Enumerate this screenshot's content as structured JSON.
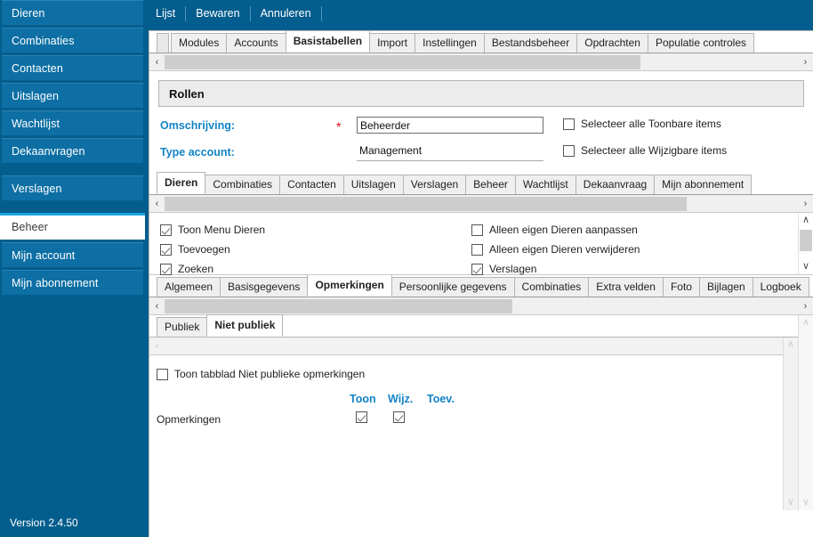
{
  "sidebar": {
    "items": [
      {
        "label": "Dieren",
        "active": false,
        "gap": false
      },
      {
        "label": "Combinaties",
        "active": false,
        "gap": false
      },
      {
        "label": "Contacten",
        "active": false,
        "gap": false
      },
      {
        "label": "Uitslagen",
        "active": false,
        "gap": false
      },
      {
        "label": "Wachtlijst",
        "active": false,
        "gap": false
      },
      {
        "label": "Dekaanvragen",
        "active": false,
        "gap": false
      },
      {
        "label": "Verslagen",
        "active": false,
        "gap": true
      },
      {
        "label": "Beheer",
        "active": true,
        "gap": true
      },
      {
        "label": "Mijn account",
        "active": false,
        "gap": false
      },
      {
        "label": "Mijn abonnement",
        "active": false,
        "gap": false
      }
    ],
    "version": "Version 2.4.50"
  },
  "topbar": {
    "items": [
      {
        "label": "Lijst"
      },
      {
        "label": "Bewaren"
      },
      {
        "label": "Annuleren"
      }
    ]
  },
  "module_tabs": [
    {
      "label": "Modules",
      "active": false
    },
    {
      "label": "Accounts",
      "active": false
    },
    {
      "label": "Basistabellen",
      "active": true
    },
    {
      "label": "Import",
      "active": false
    },
    {
      "label": "Instellingen",
      "active": false
    },
    {
      "label": "Bestandsbeheer",
      "active": false
    },
    {
      "label": "Opdrachten",
      "active": false
    },
    {
      "label": "Populatie controles",
      "active": false
    }
  ],
  "section": {
    "title": "Rollen"
  },
  "form": {
    "omschrijving_label": "Omschrijving:",
    "omschrijving_required": "*",
    "omschrijving_value": "Beheerder",
    "type_account_label": "Type account:",
    "type_account_value": "Management",
    "select_toonbare_label": "Selecteer alle Toonbare items",
    "select_toonbare_checked": false,
    "select_wijzigbare_label": "Selecteer alle Wijzigbare items",
    "select_wijzigbare_checked": false
  },
  "entity_tabs": [
    {
      "label": "Dieren",
      "active": true
    },
    {
      "label": "Combinaties",
      "active": false
    },
    {
      "label": "Contacten",
      "active": false
    },
    {
      "label": "Uitslagen",
      "active": false
    },
    {
      "label": "Verslagen",
      "active": false
    },
    {
      "label": "Beheer",
      "active": false
    },
    {
      "label": "Wachtlijst",
      "active": false
    },
    {
      "label": "Dekaanvraag",
      "active": false
    },
    {
      "label": "Mijn abonnement",
      "active": false
    }
  ],
  "permissions": {
    "left": [
      {
        "label": "Toon Menu Dieren",
        "checked": true
      },
      {
        "label": "Toevoegen",
        "checked": true
      },
      {
        "label": "Zoeken",
        "checked": true
      }
    ],
    "right": [
      {
        "label": "Alleen eigen Dieren aanpassen",
        "checked": false
      },
      {
        "label": "Alleen eigen Dieren verwijderen",
        "checked": false
      },
      {
        "label": "Verslagen",
        "checked": true
      }
    ]
  },
  "detail_tabs": [
    {
      "label": "Algemeen",
      "active": false
    },
    {
      "label": "Basisgegevens",
      "active": false
    },
    {
      "label": "Opmerkingen",
      "active": true
    },
    {
      "label": "Persoonlijke gegevens",
      "active": false
    },
    {
      "label": "Combinaties",
      "active": false
    },
    {
      "label": "Extra velden",
      "active": false
    },
    {
      "label": "Foto",
      "active": false
    },
    {
      "label": "Bijlagen",
      "active": false
    },
    {
      "label": "Logboek",
      "active": false
    }
  ],
  "sub_tabs": [
    {
      "label": "Publiek",
      "active": false
    },
    {
      "label": "Niet publiek",
      "active": true
    }
  ],
  "inner": {
    "toon_tabblad_label": "Toon tabblad Niet publieke opmerkingen",
    "toon_tabblad_checked": false,
    "col_toon": "Toon",
    "col_wijz": "Wijz.",
    "col_toev": "Toev.",
    "row_label": "Opmerkingen",
    "row_toon_checked": true,
    "row_wijz_checked": true,
    "row_toev_checked": false
  },
  "icons": {
    "scroll_left": "‹",
    "scroll_right": "›",
    "scroll_up": "∧",
    "scroll_down": "∨"
  },
  "colors": {
    "sidebar_bg": "#045e8d",
    "sidebar_item": "#0d6fa4",
    "accent_blue": "#1383c6",
    "required_red": "#e30613",
    "active_marker": "#19a6e0"
  }
}
